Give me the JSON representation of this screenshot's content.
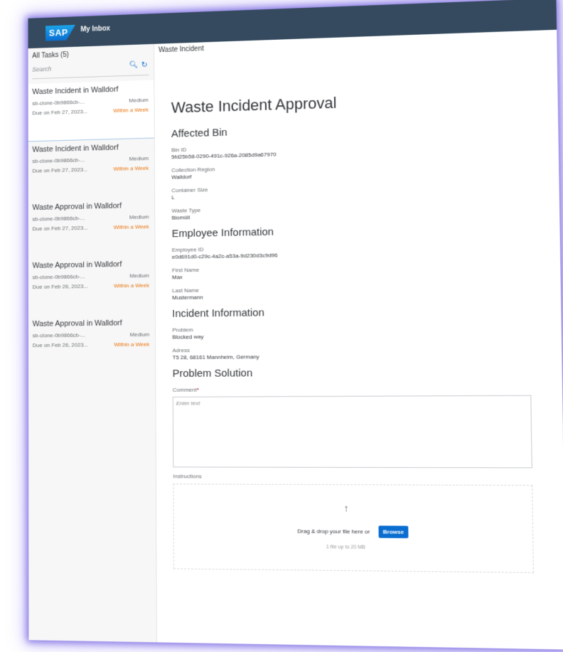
{
  "shell": {
    "logo_text": "SAP",
    "app_title": "My Inbox"
  },
  "master": {
    "header": "All Tasks (5)",
    "search_placeholder": "Search",
    "tasks": [
      {
        "title": "Waste Incident in Walldorf",
        "id": "sb-clone-0b9866cb-...",
        "priority": "Medium",
        "due": "Due on Feb 27, 2023...",
        "urgency": "Within a Week"
      },
      {
        "title": "Waste Incident in Walldorf",
        "id": "sb-clone-0b9866cb-...",
        "priority": "Medium",
        "due": "Due on Feb 27, 2023...",
        "urgency": "Within a Week"
      },
      {
        "title": "Waste Approval in Walldorf",
        "id": "sb-clone-0b9866cb-...",
        "priority": "Medium",
        "due": "Due on Feb 27, 2023...",
        "urgency": "Within a Week"
      },
      {
        "title": "Waste Approval in Walldorf",
        "id": "sb-clone-0b9866cb-...",
        "priority": "Medium",
        "due": "Due on Feb 26, 2023...",
        "urgency": "Within a Week"
      },
      {
        "title": "Waste Approval in Walldorf",
        "id": "sb-clone-0b9866cb-...",
        "priority": "Medium",
        "due": "Due on Feb 26, 2023...",
        "urgency": "Within a Week"
      }
    ]
  },
  "detail": {
    "header": "Waste Incident",
    "page_title": "Waste Incident Approval",
    "affected_bin": {
      "title": "Affected Bin",
      "bin_id_label": "Bin ID",
      "bin_id_value": "5fd25b58-0290-491c-926a-2085d9a67970",
      "region_label": "Collection Region",
      "region_value": "Walldorf",
      "size_label": "Container Size",
      "size_value": "L",
      "type_label": "Waste Type",
      "type_value": "Biomüll"
    },
    "employee": {
      "title": "Employee Information",
      "id_label": "Employee ID",
      "id_value": "e0d691d0-c29c-4a2c-a53a-9d230d3c9d96",
      "first_label": "First Name",
      "first_value": "Max",
      "last_label": "Last Name",
      "last_value": "Mustermann"
    },
    "incident": {
      "title": "Incident Information",
      "problem_label": "Problem",
      "problem_value": "Blocked way",
      "address_label": "Adress",
      "address_value": "T5 28, 68161 Mannheim, Germany"
    },
    "solution": {
      "title": "Problem Solution",
      "comment_label": "Comment",
      "required_mark": "*",
      "comment_placeholder": "Enter text",
      "comment_value": "",
      "instructions_label": "Instructions",
      "upload_icon": "↑",
      "drop_text": "Drag & drop your file here or",
      "browse_label": "Browse",
      "size_text": "1 file up to 20 MB"
    }
  },
  "colors": {
    "shell": "#354a5f",
    "accent": "#0a6ed1",
    "urgency": "#e9730c",
    "glow": "#6856dc"
  }
}
